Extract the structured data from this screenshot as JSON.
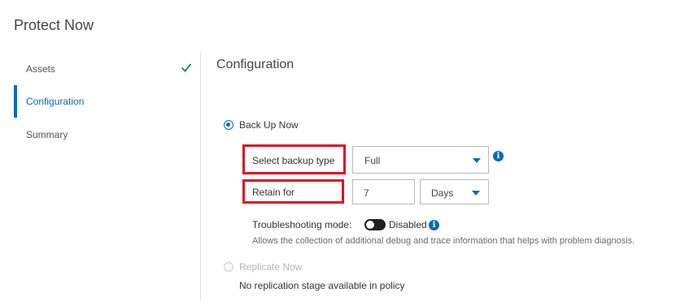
{
  "page": {
    "title": "Protect Now"
  },
  "steps": [
    {
      "label": "Assets",
      "state": "complete"
    },
    {
      "label": "Configuration",
      "state": "active"
    },
    {
      "label": "Summary",
      "state": "pending"
    }
  ],
  "config": {
    "title": "Configuration",
    "backup_now": {
      "label": "Back Up Now",
      "selected": true,
      "backup_type_label": "Select backup type",
      "backup_type_value": "Full",
      "retain_label": "Retain for",
      "retain_value": "7",
      "retain_unit": "Days",
      "troubleshooting_label": "Troubleshooting mode:",
      "troubleshooting_state": "Disabled",
      "troubleshooting_help": "Allows the collection of additional debug and trace information that helps with problem diagnosis."
    },
    "replicate_now": {
      "label": "Replicate Now",
      "selected": false,
      "note": "No replication stage available in policy"
    }
  },
  "colors": {
    "accent": "#0b6bb8",
    "highlight": "#e0101f",
    "success": "#1b8a4a"
  }
}
